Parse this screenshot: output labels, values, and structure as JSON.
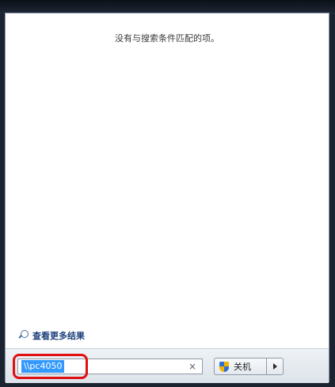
{
  "results": {
    "no_results_text": "没有与搜索条件匹配的项。",
    "see_more_label": "查看更多结果"
  },
  "search": {
    "value": "\\\\pc4050",
    "clear_symbol": "×"
  },
  "power": {
    "shutdown_label": "关机"
  },
  "colors": {
    "highlight": "#e01010",
    "selection": "#3399ff",
    "link": "#1c3f7c"
  },
  "icons": {
    "see_more": "search-icon",
    "shutdown": "uac-shield-icon",
    "options": "arrow-right-icon",
    "clear": "close-icon"
  }
}
